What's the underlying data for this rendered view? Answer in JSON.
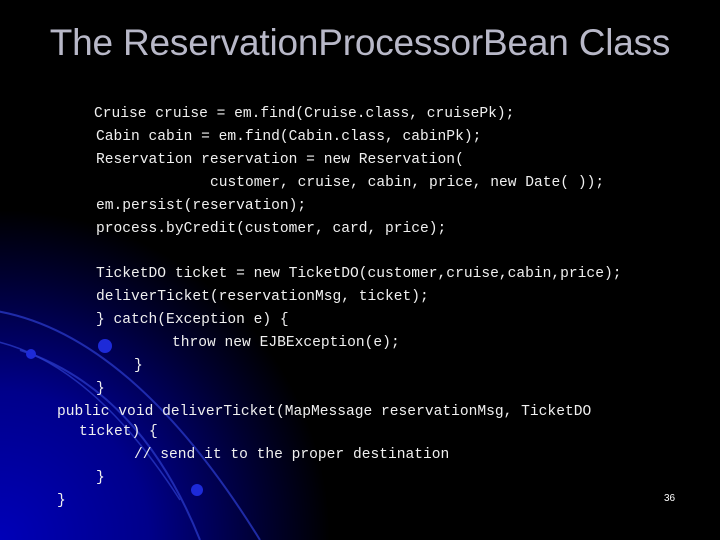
{
  "slide": {
    "title": "The ReservationProcessorBean Class",
    "page_number": "36",
    "code_lines": [
      "Cruise cruise = em.find(Cruise.class, cruisePk);",
      "Cabin cabin = em.find(Cabin.class, cabinPk);",
      "Reservation reservation = new Reservation(",
      "customer, cruise, cabin, price, new Date( ));",
      "em.persist(reservation);",
      "process.byCredit(customer, card, price);",
      "TicketDO ticket = new TicketDO(customer,cruise,cabin,price);",
      "deliverTicket(reservationMsg, ticket);",
      "} catch(Exception e) {",
      "throw new EJBException(e);",
      "}",
      "}",
      "public void deliverTicket(MapMessage reservationMsg, TicketDO",
      "ticket) {",
      "// send it to the proper destination",
      "}",
      "}"
    ]
  }
}
